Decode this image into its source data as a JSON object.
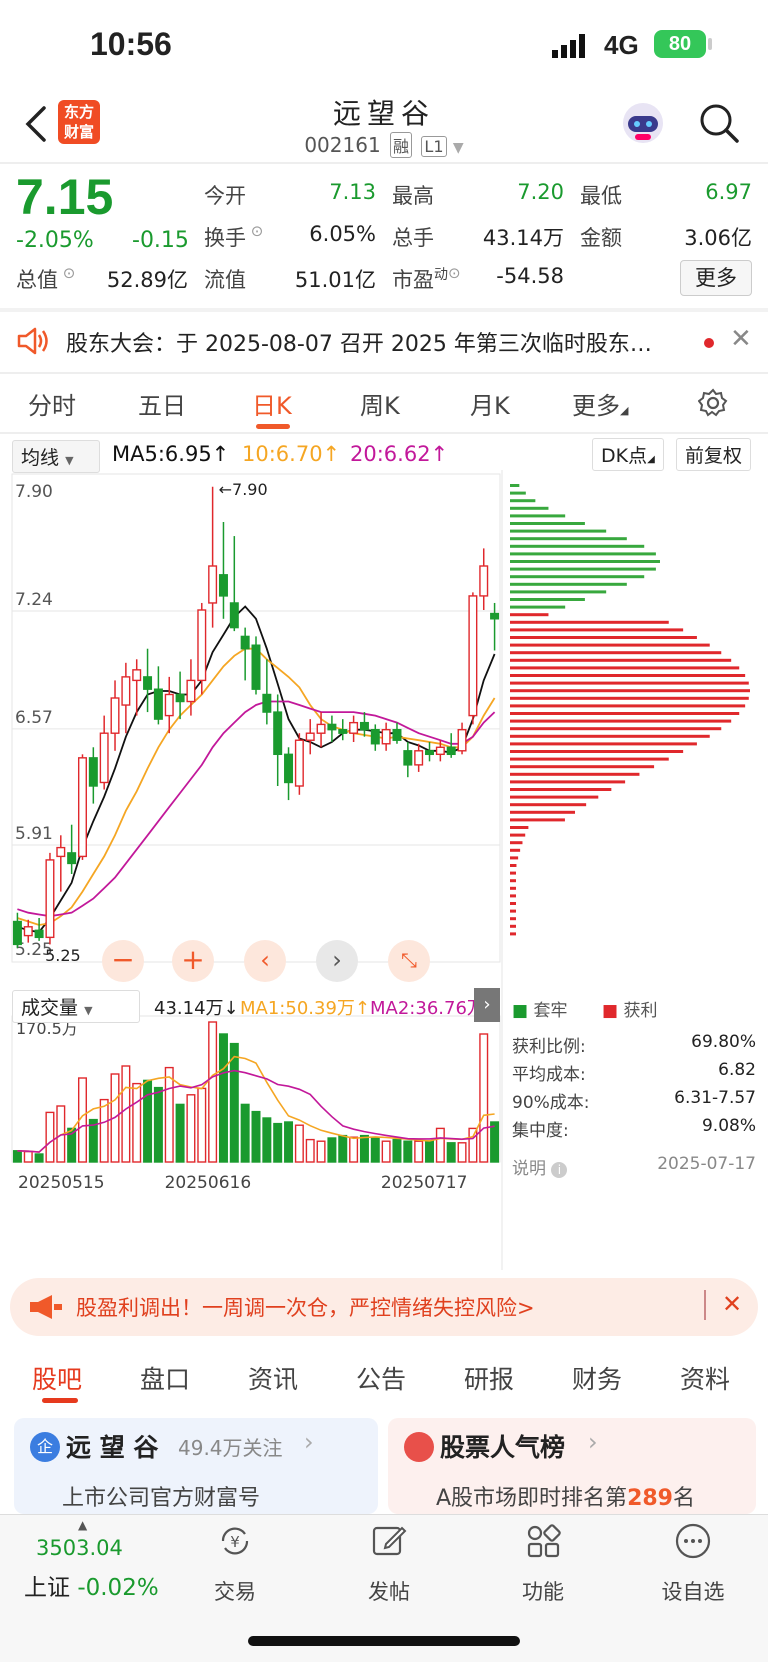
{
  "status": {
    "time": "10:56",
    "network": "4G",
    "battery": "80"
  },
  "header": {
    "logo_line1": "东方",
    "logo_line2": "财富",
    "stock_name": "远望谷",
    "stock_code": "002161",
    "tag_margin": "融",
    "tag_level": "L1"
  },
  "quote": {
    "price": "7.15",
    "change_pct": "-2.05%",
    "change_amt": "-0.15",
    "open_label": "今开",
    "open": "7.13",
    "high_label": "最高",
    "high": "7.20",
    "low_label": "最低",
    "low": "6.97",
    "turnover_label": "换手",
    "turnover": "6.05%",
    "volume_label": "总手",
    "volume": "43.14万",
    "amount_label": "金额",
    "amount": "3.06亿",
    "mktcap_label": "总值",
    "mktcap": "52.89亿",
    "float_label": "流值",
    "float_cap": "51.01亿",
    "pe_label": "市盈",
    "pe_sup": "动",
    "pe": "-54.58",
    "more": "更多"
  },
  "announcement": {
    "text": "股东大会：于 2025-08-07 召开 2025 年第三次临时股东…"
  },
  "kline_tabs": [
    "分时",
    "五日",
    "日K",
    "周K",
    "月K",
    "更多"
  ],
  "toolbar": {
    "indicator": "均线",
    "ma5": "MA5:6.95↑",
    "ma10": "10:6.70↑",
    "ma20": "20:6.62↑",
    "dk": "DK点",
    "adjust": "前复权"
  },
  "colors": {
    "up": "#e0282c",
    "down": "#1a9a2e",
    "ma5": "#111111",
    "ma10": "#f5a623",
    "ma20": "#c2189a",
    "accent": "#f0592a"
  },
  "chart_data": {
    "type": "candlestick",
    "y_ticks": [
      "7.90",
      "7.24",
      "6.57",
      "5.91",
      "5.25"
    ],
    "high_marker": "7.90",
    "low_marker": "5.25",
    "candles": [
      {
        "o": 5.43,
        "h": 5.48,
        "l": 5.28,
        "c": 5.3
      },
      {
        "o": 5.35,
        "h": 5.44,
        "l": 5.31,
        "c": 5.4
      },
      {
        "o": 5.38,
        "h": 5.45,
        "l": 5.32,
        "c": 5.34
      },
      {
        "o": 5.34,
        "h": 5.82,
        "l": 5.3,
        "c": 5.78
      },
      {
        "o": 5.8,
        "h": 5.92,
        "l": 5.6,
        "c": 5.85
      },
      {
        "o": 5.82,
        "h": 5.98,
        "l": 5.7,
        "c": 5.76
      },
      {
        "o": 5.8,
        "h": 6.38,
        "l": 5.78,
        "c": 6.36
      },
      {
        "o": 6.36,
        "h": 6.42,
        "l": 6.1,
        "c": 6.2
      },
      {
        "o": 6.22,
        "h": 6.6,
        "l": 6.18,
        "c": 6.5
      },
      {
        "o": 6.5,
        "h": 6.8,
        "l": 6.4,
        "c": 6.7
      },
      {
        "o": 6.66,
        "h": 6.9,
        "l": 6.5,
        "c": 6.82
      },
      {
        "o": 6.8,
        "h": 6.92,
        "l": 6.6,
        "c": 6.86
      },
      {
        "o": 6.82,
        "h": 6.98,
        "l": 6.62,
        "c": 6.75
      },
      {
        "o": 6.75,
        "h": 6.88,
        "l": 6.55,
        "c": 6.58
      },
      {
        "o": 6.6,
        "h": 6.82,
        "l": 6.5,
        "c": 6.72
      },
      {
        "o": 6.72,
        "h": 6.85,
        "l": 6.58,
        "c": 6.68
      },
      {
        "o": 6.68,
        "h": 6.92,
        "l": 6.6,
        "c": 6.8
      },
      {
        "o": 6.8,
        "h": 7.24,
        "l": 6.72,
        "c": 7.2
      },
      {
        "o": 7.24,
        "h": 7.9,
        "l": 7.1,
        "c": 7.45
      },
      {
        "o": 7.4,
        "h": 7.7,
        "l": 7.15,
        "c": 7.28
      },
      {
        "o": 7.24,
        "h": 7.62,
        "l": 7.08,
        "c": 7.1
      },
      {
        "o": 7.05,
        "h": 7.1,
        "l": 6.8,
        "c": 6.98
      },
      {
        "o": 7.0,
        "h": 7.05,
        "l": 6.72,
        "c": 6.75
      },
      {
        "o": 6.72,
        "h": 6.92,
        "l": 6.55,
        "c": 6.62
      },
      {
        "o": 6.62,
        "h": 6.72,
        "l": 6.2,
        "c": 6.38
      },
      {
        "o": 6.38,
        "h": 6.42,
        "l": 6.12,
        "c": 6.22
      },
      {
        "o": 6.2,
        "h": 6.5,
        "l": 6.15,
        "c": 6.46
      },
      {
        "o": 6.46,
        "h": 6.58,
        "l": 6.38,
        "c": 6.5
      },
      {
        "o": 6.5,
        "h": 6.62,
        "l": 6.42,
        "c": 6.55
      },
      {
        "o": 6.55,
        "h": 6.6,
        "l": 6.45,
        "c": 6.52
      },
      {
        "o": 6.52,
        "h": 6.58,
        "l": 6.46,
        "c": 6.5
      },
      {
        "o": 6.5,
        "h": 6.6,
        "l": 6.45,
        "c": 6.56
      },
      {
        "o": 6.56,
        "h": 6.62,
        "l": 6.48,
        "c": 6.52
      },
      {
        "o": 6.52,
        "h": 6.55,
        "l": 6.4,
        "c": 6.44
      },
      {
        "o": 6.44,
        "h": 6.56,
        "l": 6.4,
        "c": 6.52
      },
      {
        "o": 6.52,
        "h": 6.56,
        "l": 6.44,
        "c": 6.46
      },
      {
        "o": 6.4,
        "h": 6.45,
        "l": 6.25,
        "c": 6.32
      },
      {
        "o": 6.32,
        "h": 6.44,
        "l": 6.28,
        "c": 6.4
      },
      {
        "o": 6.4,
        "h": 6.45,
        "l": 6.34,
        "c": 6.38
      },
      {
        "o": 6.38,
        "h": 6.46,
        "l": 6.34,
        "c": 6.42
      },
      {
        "o": 6.42,
        "h": 6.5,
        "l": 6.36,
        "c": 6.38
      },
      {
        "o": 6.4,
        "h": 6.56,
        "l": 6.38,
        "c": 6.52
      },
      {
        "o": 6.6,
        "h": 7.3,
        "l": 6.55,
        "c": 7.28
      },
      {
        "o": 7.28,
        "h": 7.55,
        "l": 7.2,
        "c": 7.45
      },
      {
        "o": 7.18,
        "h": 7.24,
        "l": 6.97,
        "c": 7.15
      }
    ],
    "ma5": [
      5.4,
      5.38,
      5.37,
      5.45,
      5.55,
      5.65,
      5.85,
      6.0,
      6.14,
      6.3,
      6.48,
      6.62,
      6.72,
      6.74,
      6.74,
      6.72,
      6.72,
      6.8,
      6.96,
      7.06,
      7.16,
      7.22,
      7.15,
      6.98,
      6.78,
      6.58,
      6.47,
      6.45,
      6.42,
      6.45,
      6.5,
      6.52,
      6.52,
      6.51,
      6.5,
      6.5,
      6.45,
      6.43,
      6.4,
      6.4,
      6.39,
      6.42,
      6.58,
      6.8,
      6.95
    ],
    "ma10": [
      5.45,
      5.43,
      5.41,
      5.42,
      5.46,
      5.51,
      5.6,
      5.7,
      5.8,
      5.92,
      6.06,
      6.17,
      6.3,
      6.42,
      6.52,
      6.6,
      6.66,
      6.72,
      6.8,
      6.88,
      6.94,
      6.98,
      6.98,
      6.92,
      6.87,
      6.82,
      6.76,
      6.66,
      6.58,
      6.54,
      6.52,
      6.5,
      6.49,
      6.48,
      6.47,
      6.48,
      6.47,
      6.46,
      6.45,
      6.44,
      6.42,
      6.42,
      6.48,
      6.6,
      6.7
    ],
    "ma20": [
      5.5,
      5.48,
      5.47,
      5.46,
      5.47,
      5.48,
      5.52,
      5.56,
      5.62,
      5.68,
      5.76,
      5.84,
      5.92,
      6.0,
      6.08,
      6.16,
      6.24,
      6.32,
      6.42,
      6.5,
      6.56,
      6.62,
      6.66,
      6.68,
      6.68,
      6.68,
      6.66,
      6.64,
      6.62,
      6.62,
      6.62,
      6.62,
      6.61,
      6.6,
      6.58,
      6.56,
      6.53,
      6.5,
      6.48,
      6.46,
      6.44,
      6.44,
      6.48,
      6.56,
      6.62
    ],
    "volume_label": "成交量",
    "volume_today": "43.14万↓",
    "vol_ma1": "MA1:50.39万↑",
    "vol_ma2": "MA2:36.76万↑",
    "volume_max": "170.5万",
    "volumes": [
      14,
      13,
      10,
      62,
      70,
      42,
      105,
      53,
      78,
      110,
      120,
      98,
      102,
      93,
      118,
      72,
      84,
      92,
      175,
      160,
      148,
      72,
      63,
      55,
      48,
      50,
      46,
      28,
      26,
      30,
      33,
      31,
      33,
      30,
      26,
      28,
      26,
      26,
      26,
      42,
      24,
      24,
      42,
      160,
      50
    ],
    "dates": [
      "20250515",
      "20250616",
      "20250717"
    ]
  },
  "chip": {
    "legend_trapped": "套牢",
    "legend_profit": "获利",
    "rows": [
      {
        "label": "获利比例:",
        "value": "69.80%"
      },
      {
        "label": "平均成本:",
        "value": "6.82"
      },
      {
        "label": "90%成本:",
        "value": "6.31-7.57"
      },
      {
        "label": "集中度:",
        "value": "9.08%"
      }
    ],
    "note_label": "说明",
    "date": "2025-07-17"
  },
  "banner": {
    "text": "股盈利调出！一周调一次仓，严控情绪失控风险>"
  },
  "bottom_tabs": [
    "股吧",
    "盘口",
    "资讯",
    "公告",
    "研报",
    "财务",
    "资料"
  ],
  "cards": {
    "left_title": "远 望 谷",
    "left_follow": "49.4万关注",
    "left_sub": "上市公司官方财富号",
    "right_title": "股票人气榜",
    "right_sub_prefix": "A股市场即时排名第",
    "right_rank": "289",
    "right_sub_suffix": "名"
  },
  "index": {
    "value": "3503.04",
    "name": "上证",
    "change": "-0.02%"
  },
  "nav": [
    "交易",
    "发帖",
    "功能",
    "设自选"
  ]
}
